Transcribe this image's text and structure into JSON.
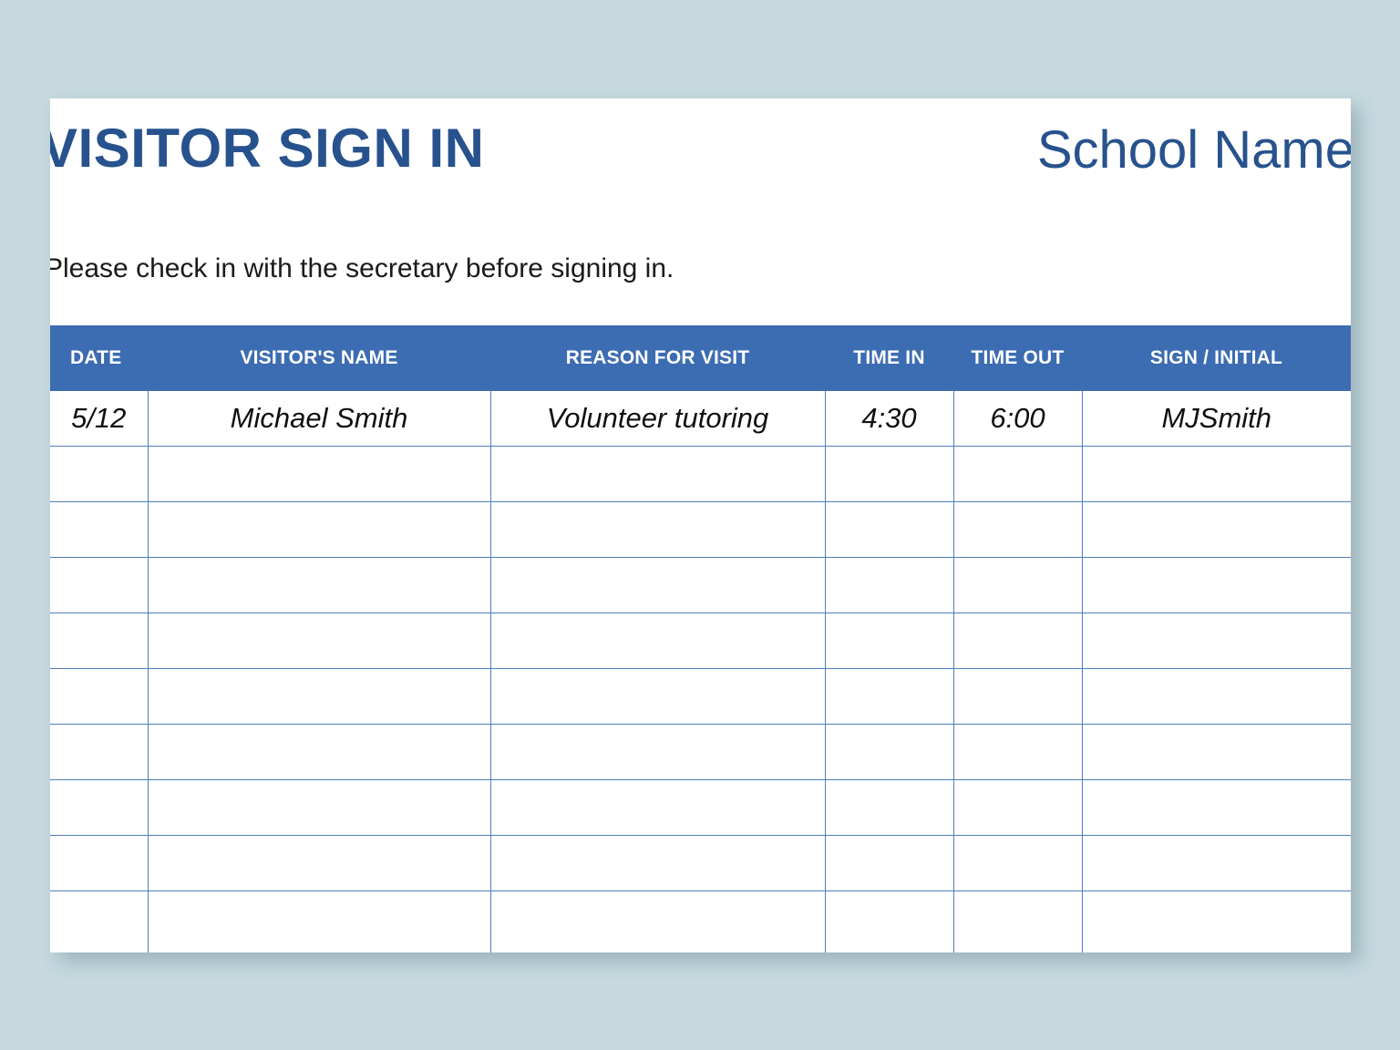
{
  "document": {
    "title": "VISITOR SIGN IN",
    "org_name": "School Name",
    "instruction": "Please check in with the secretary before signing in."
  },
  "colors": {
    "page_background": "#c5d9df",
    "sheet_background": "#ffffff",
    "title_blue": "#27528d",
    "header_row_blue": "#3c6cb2",
    "grid_line_blue": "#4f7ebc",
    "header_text": "#ffffff",
    "body_text": "#101010"
  },
  "table": {
    "columns": [
      {
        "key": "date",
        "label": "DATE"
      },
      {
        "key": "name",
        "label": "VISITOR'S NAME"
      },
      {
        "key": "reason",
        "label": "REASON FOR VISIT"
      },
      {
        "key": "time_in",
        "label": "TIME IN"
      },
      {
        "key": "time_out",
        "label": "TIME OUT"
      },
      {
        "key": "sign",
        "label": "SIGN / INITIAL"
      }
    ],
    "rows": [
      {
        "date": "5/12",
        "name": "Michael Smith",
        "reason": "Volunteer tutoring",
        "time_in": "4:30",
        "time_out": "6:00",
        "sign": "MJSmith"
      },
      {
        "date": "",
        "name": "",
        "reason": "",
        "time_in": "",
        "time_out": "",
        "sign": ""
      },
      {
        "date": "",
        "name": "",
        "reason": "",
        "time_in": "",
        "time_out": "",
        "sign": ""
      },
      {
        "date": "",
        "name": "",
        "reason": "",
        "time_in": "",
        "time_out": "",
        "sign": ""
      },
      {
        "date": "",
        "name": "",
        "reason": "",
        "time_in": "",
        "time_out": "",
        "sign": ""
      },
      {
        "date": "",
        "name": "",
        "reason": "",
        "time_in": "",
        "time_out": "",
        "sign": ""
      },
      {
        "date": "",
        "name": "",
        "reason": "",
        "time_in": "",
        "time_out": "",
        "sign": ""
      },
      {
        "date": "",
        "name": "",
        "reason": "",
        "time_in": "",
        "time_out": "",
        "sign": ""
      },
      {
        "date": "",
        "name": "",
        "reason": "",
        "time_in": "",
        "time_out": "",
        "sign": ""
      },
      {
        "date": "",
        "name": "",
        "reason": "",
        "time_in": "",
        "time_out": "",
        "sign": ""
      }
    ]
  }
}
